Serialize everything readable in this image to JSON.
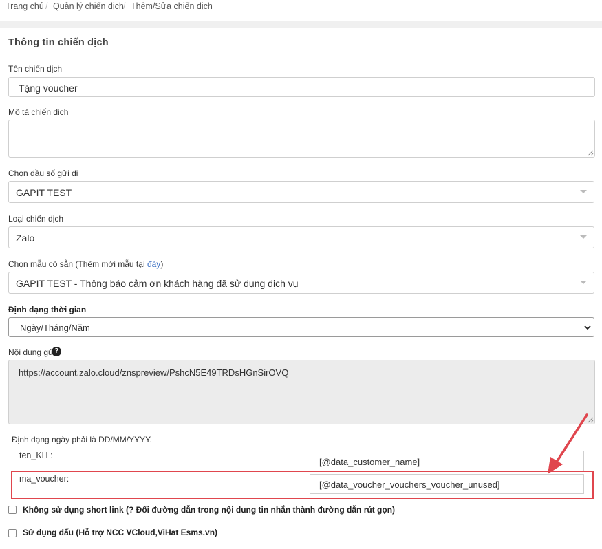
{
  "breadcrumb": {
    "items": [
      "Trang chủ",
      "Quản lý chiến dịch",
      "Thêm/Sửa chiến dịch"
    ],
    "separator": "/"
  },
  "section": {
    "title": "Thông tin chiến dịch"
  },
  "form": {
    "campaign_name": {
      "label": "Tên chiến dịch",
      "value": "Tặng voucher"
    },
    "campaign_desc": {
      "label": "Mô tả chiến dịch",
      "value": ""
    },
    "sender": {
      "label": "Chọn đầu số gửi đi",
      "value": "GAPIT TEST"
    },
    "campaign_type": {
      "label": "Loại chiến dịch",
      "value": "Zalo"
    },
    "template": {
      "label_prefix": "Chọn mẫu có sẵn (Thêm mới mẫu tại ",
      "label_link": "đây",
      "label_suffix": ")",
      "value": "GAPIT TEST - Thông báo cảm ơn khách hàng đã sử dụng dịch vụ"
    },
    "time_format": {
      "label": "Định dạng thời gian",
      "value": "Ngày/Tháng/Năm"
    },
    "content": {
      "label": "Nội dung gửi",
      "help": "?",
      "value": "https://account.zalo.cloud/znspreview/PshcN5E49TRDsHGnSirOVQ=="
    },
    "date_note": "Định dạng ngày phải là DD/MM/YYYY.",
    "params": [
      {
        "name": "ten_KH :",
        "value": "[@data_customer_name]"
      },
      {
        "name": "ma_voucher:",
        "value": "[@data_voucher_vouchers_voucher_unused]"
      }
    ],
    "options": [
      {
        "label": "Không sử dụng short link (? Đổi đường dẫn trong nội dung tin nhắn thành đường dẫn rút gọn)",
        "checked": false
      },
      {
        "label": "Sử dụng dấu (Hỗ trợ NCC VCloud,ViHat Esms.vn)",
        "checked": false
      }
    ]
  },
  "colors": {
    "highlight": "#e0464e",
    "link": "#3a6fc4",
    "readonly_bg": "#ececec"
  }
}
